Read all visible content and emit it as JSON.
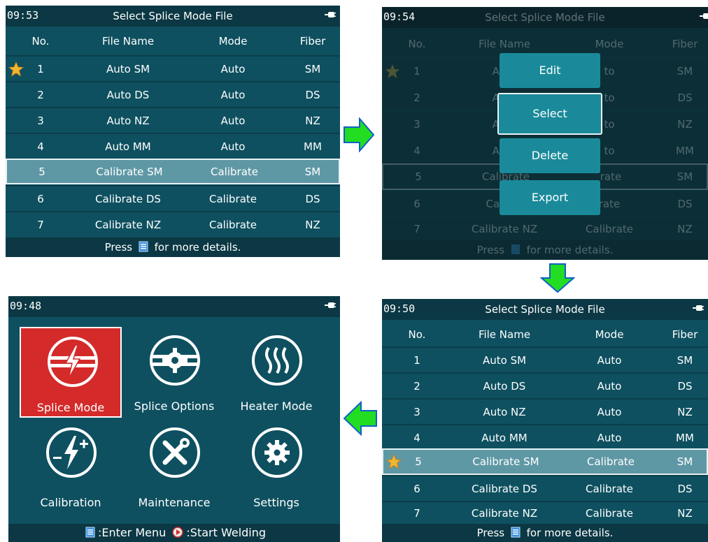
{
  "common": {
    "columns": {
      "no": "No.",
      "name": "File Name",
      "mode": "Mode",
      "fiber": "Fiber"
    },
    "footer": {
      "press": "Press",
      "details": "for more details."
    },
    "title": "Select Splice Mode File"
  },
  "panel1": {
    "time": "09:53",
    "rows": [
      {
        "no": "1",
        "name": "Auto SM",
        "mode": "Auto",
        "fiber": "SM"
      },
      {
        "no": "2",
        "name": "Auto DS",
        "mode": "Auto",
        "fiber": "DS"
      },
      {
        "no": "3",
        "name": "Auto NZ",
        "mode": "Auto",
        "fiber": "NZ"
      },
      {
        "no": "4",
        "name": "Auto MM",
        "mode": "Auto",
        "fiber": "MM"
      },
      {
        "no": "5",
        "name": "Calibrate SM",
        "mode": "Calibrate",
        "fiber": "SM"
      },
      {
        "no": "6",
        "name": "Calibrate DS",
        "mode": "Calibrate",
        "fiber": "DS"
      },
      {
        "no": "7",
        "name": "Calibrate NZ",
        "mode": "Calibrate",
        "fiber": "NZ"
      }
    ]
  },
  "panel2": {
    "time": "09:54",
    "rows": [
      {
        "no": "1",
        "name": "Auto",
        "mode": "to",
        "fiber": "SM"
      },
      {
        "no": "2",
        "name": "Auto",
        "mode": "to",
        "fiber": "DS"
      },
      {
        "no": "3",
        "name": "Auto",
        "mode": "to",
        "fiber": "NZ"
      },
      {
        "no": "4",
        "name": "Auto",
        "mode": "to",
        "fiber": "MM"
      },
      {
        "no": "5",
        "name": "Calibrate",
        "mode": "rate",
        "fiber": "SM"
      },
      {
        "no": "6",
        "name": "Calibra",
        "mode": "rate",
        "fiber": "DS"
      },
      {
        "no": "7",
        "name": "Calibrate NZ",
        "mode": "Calibrate",
        "fiber": "NZ"
      }
    ],
    "menu": {
      "edit": "Edit",
      "select": "Select",
      "delete": "Delete",
      "export": "Export"
    }
  },
  "panel3": {
    "time": "09:50",
    "rows": [
      {
        "no": "1",
        "name": "Auto SM",
        "mode": "Auto",
        "fiber": "SM"
      },
      {
        "no": "2",
        "name": "Auto DS",
        "mode": "Auto",
        "fiber": "DS"
      },
      {
        "no": "3",
        "name": "Auto NZ",
        "mode": "Auto",
        "fiber": "NZ"
      },
      {
        "no": "4",
        "name": "Auto MM",
        "mode": "Auto",
        "fiber": "MM"
      },
      {
        "no": "5",
        "name": "Calibrate SM",
        "mode": "Calibrate",
        "fiber": "SM"
      },
      {
        "no": "6",
        "name": "Calibrate DS",
        "mode": "Calibrate",
        "fiber": "DS"
      },
      {
        "no": "7",
        "name": "Calibrate NZ",
        "mode": "Calibrate",
        "fiber": "NZ"
      }
    ]
  },
  "panel4": {
    "time": "09:48",
    "tiles": {
      "splice_mode": "Splice Mode",
      "splice_options": "Splice Options",
      "heater_mode": "Heater Mode",
      "calibration": "Calibration",
      "maintenance": "Maintenance",
      "settings": "Settings"
    },
    "footer": {
      "enter": ":Enter Menu",
      "start": ":Start Welding"
    }
  },
  "colors": {
    "screen_bg": "#0e5060",
    "bar_bg": "#0b3844",
    "selected_row": "#5f98a5",
    "menu_button": "#1a8a9a",
    "active_tile": "#d42a2a",
    "arrow": "#22dd22"
  },
  "icons": [
    "star-icon",
    "plug-icon",
    "document-icon",
    "play-icon",
    "splice-mode-icon",
    "splice-options-icon",
    "heater-icon",
    "calibration-icon",
    "maintenance-icon",
    "settings-icon",
    "arrow-right-icon",
    "arrow-down-icon",
    "arrow-left-icon"
  ]
}
